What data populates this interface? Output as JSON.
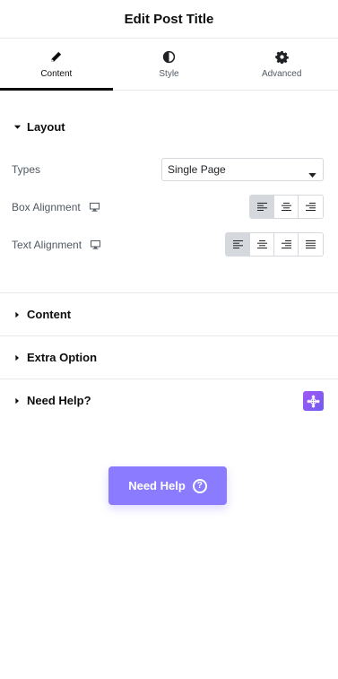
{
  "header": {
    "title": "Edit Post Title"
  },
  "tabs": [
    {
      "label": "Content",
      "icon": "pencil-icon",
      "active": true
    },
    {
      "label": "Style",
      "icon": "half-circle-icon",
      "active": false
    },
    {
      "label": "Advanced",
      "icon": "gear-icon",
      "active": false
    }
  ],
  "layout": {
    "title": "Layout",
    "types": {
      "label": "Types",
      "value": "Single Page"
    },
    "box_alignment": {
      "label": "Box Alignment",
      "options": [
        "left",
        "center",
        "right"
      ],
      "selected": "left"
    },
    "text_alignment": {
      "label": "Text Alignment",
      "options": [
        "left",
        "center",
        "right",
        "justify"
      ],
      "selected": "left"
    }
  },
  "sections": [
    {
      "title": "Content"
    },
    {
      "title": "Extra Option"
    },
    {
      "title": "Need Help?"
    }
  ],
  "help_button": {
    "label": "Need Help",
    "icon": "question-circle-icon"
  },
  "colors": {
    "accent": "#8b7cff",
    "badge": "#8a5cf5",
    "active_toggle": "#d5d8dc"
  }
}
